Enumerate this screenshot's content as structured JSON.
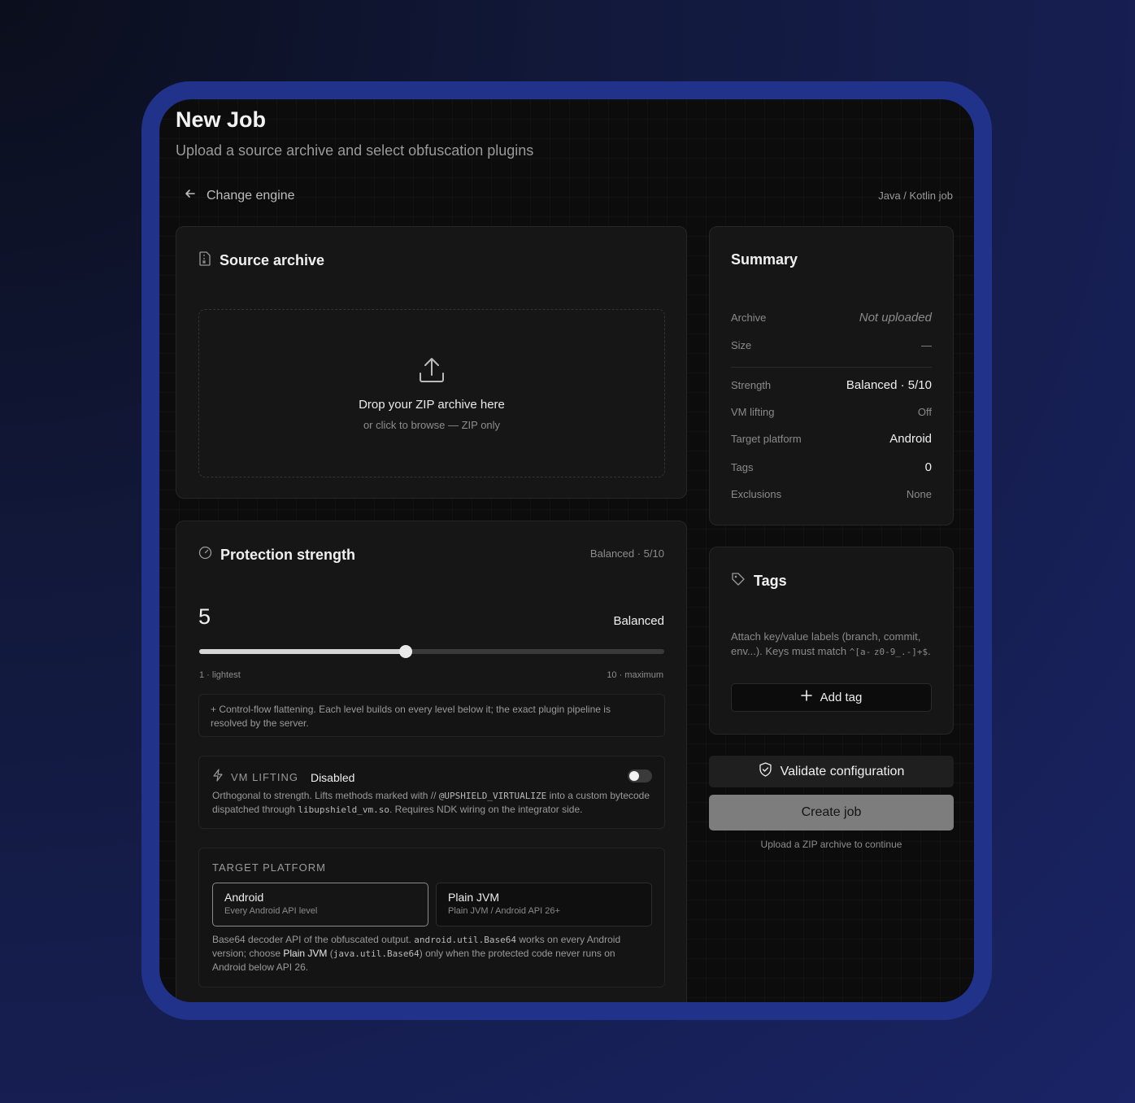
{
  "header": {
    "title": "New Job",
    "subtitle": "Upload a source archive and select obfuscation plugins",
    "back_label": "Change engine",
    "job_type": "Java / Kotlin job"
  },
  "source_archive": {
    "title": "Source archive",
    "drop_main": "Drop your ZIP archive here",
    "drop_sub": "or click to browse — ZIP only"
  },
  "protection": {
    "title": "Protection strength",
    "badge": "Balanced · 5/10",
    "level_value": "5",
    "level_name": "Balanced",
    "level_fraction": 0.4444,
    "min_label": "1 · lightest",
    "max_label": "10 · maximum",
    "description": "+ Control-flow flattening. Each level builds on every level below it; the exact plugin pipeline is resolved by the server."
  },
  "vm_lifting": {
    "label": "VM LIFTING",
    "state": "Disabled",
    "desc_1": "Orthogonal to strength. Lifts methods marked with //",
    "code_1": "@UPSHIELD_VIRTUALIZE",
    "desc_2": "into a custom",
    "desc_3": "bytecode dispatched through",
    "code_2": "libupshield_vm.so",
    "desc_4": ". Requires NDK wiring on the integrator side."
  },
  "target_platform": {
    "label": "TARGET PLATFORM",
    "options": [
      {
        "title": "Android",
        "subtitle": "Every Android API level"
      },
      {
        "title": "Plain JVM",
        "subtitle": "Plain JVM / Android API 26+"
      }
    ],
    "note_1": "Base64 decoder API of the obfuscated output.",
    "note_code_1": "android.util.Base64",
    "note_2": "works on every Android version; choose",
    "note_bold": "Plain JVM",
    "note_3": "(",
    "note_code_2": "java.util.Base64",
    "note_4": ") only when the protected code never runs on Android below API 26."
  },
  "summary": {
    "title": "Summary",
    "archive_key": "Archive",
    "archive_val": "Not uploaded",
    "size_key": "Size",
    "size_val": "—",
    "strength_key": "Strength",
    "strength_val": "Balanced · 5/10",
    "vm_key": "VM lifting",
    "vm_val": "Off",
    "platform_key": "Target platform",
    "platform_val": "Android",
    "tags_key": "Tags",
    "tags_val": "0",
    "excl_key": "Exclusions",
    "excl_val": "None"
  },
  "tags": {
    "title": "Tags",
    "desc_1": "Attach key/value labels (branch,",
    "desc_2": "commit, env...). Keys must match",
    "code_1": "^[a-",
    "code_2": "z0-9_.-]+$",
    "desc_end": ".",
    "add_label": "Add tag"
  },
  "actions": {
    "validate_label": "Validate configuration",
    "create_label": "Create job",
    "hint": "Upload a ZIP archive to continue"
  }
}
